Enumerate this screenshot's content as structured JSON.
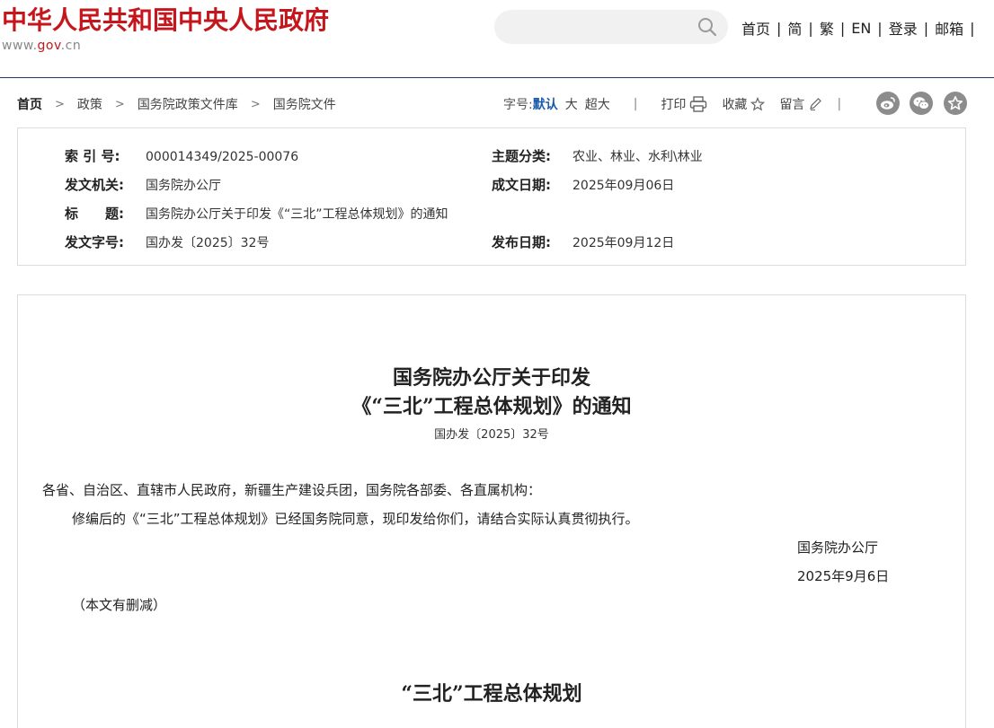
{
  "header": {
    "site_title": "中华人民共和国中央人民政府",
    "url_prefix": "www.",
    "url_domain": "gov",
    "url_suffix": ".cn",
    "search": {
      "placeholder": "",
      "icon": "search-icon"
    },
    "links": [
      "首页",
      "简",
      "繁",
      "EN",
      "登录",
      "邮箱"
    ],
    "separator": "|"
  },
  "breadcrumb": {
    "items": [
      "首页",
      "政策",
      "国务院政策文件库",
      "国务院文件"
    ],
    "arrow": ">"
  },
  "toolbar": {
    "font_size_label": "字号:",
    "font_sizes": [
      "默认",
      "大",
      "超大"
    ],
    "active_font_size": "默认",
    "divider": "|",
    "print_label": "打印",
    "favorite_label": "收藏",
    "comment_label": "留言",
    "share_icons": [
      "weibo-icon",
      "wechat-icon",
      "star-icon"
    ]
  },
  "info": {
    "index_label": "索 引 号:",
    "index_value": "000014349/2025-00076",
    "topic_label": "主题分类:",
    "topic_value": "农业、林业、水利\\林业",
    "issuer_label": "发文机关:",
    "issuer_value": "国务院办公厅",
    "written_label": "成文日期:",
    "written_value": "2025年09月06日",
    "title_label": "标　　题:",
    "title_value": "国务院办公厅关于印发《“三北”工程总体规划》的通知",
    "docno_label": "发文字号:",
    "docno_value": "国办发〔2025〕32号",
    "published_label": "发布日期:",
    "published_value": "2025年09月12日"
  },
  "document": {
    "title_line1": "国务院办公厅关于印发",
    "title_line2": "《“三北”工程总体规划》的通知",
    "doc_number": "国办发〔2025〕32号",
    "salutation": "各省、自治区、直辖市人民政府，新疆生产建设兵团，国务院各部委、各直属机构：",
    "body": "修编后的《“三北”工程总体规划》已经国务院同意，现印发给你们，请结合实际认真贯彻执行。",
    "signer": "国务院办公厅",
    "date": "2025年9月6日",
    "note": "（本文有删减）",
    "subtitle": "“三北”工程总体规划"
  },
  "colors": {
    "brand_red": "#c4161c",
    "accent_blue": "#1a5aa8",
    "header_line": "#1e3a6e"
  }
}
